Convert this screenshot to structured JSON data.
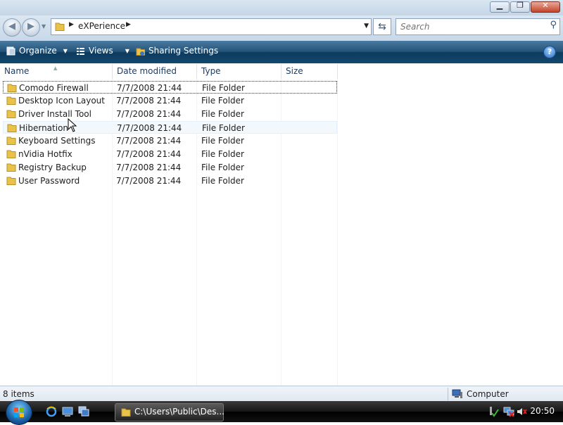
{
  "window": {
    "caption_buttons": {
      "minimize": "▁",
      "maximize": "❐",
      "close": "✕"
    }
  },
  "address": {
    "crumb": "eXPerience",
    "search_placeholder": "Search"
  },
  "toolbar": {
    "organize_label": "Organize",
    "views_label": "Views",
    "sharing_label": "Sharing Settings",
    "help_label": "?"
  },
  "columns": [
    "Name",
    "Date modified",
    "Type",
    "Size"
  ],
  "rows": [
    {
      "name": "Comodo Firewall",
      "date": "7/7/2008 21:44",
      "type": "File Folder"
    },
    {
      "name": "Desktop Icon Layout",
      "date": "7/7/2008 21:44",
      "type": "File Folder"
    },
    {
      "name": "Driver Install Tool",
      "date": "7/7/2008 21:44",
      "type": "File Folder"
    },
    {
      "name": "Hibernation",
      "date": "7/7/2008 21:44",
      "type": "File Folder"
    },
    {
      "name": "Keyboard Settings",
      "date": "7/7/2008 21:44",
      "type": "File Folder"
    },
    {
      "name": "nVidia Hotfix",
      "date": "7/7/2008 21:44",
      "type": "File Folder"
    },
    {
      "name": "Registry Backup",
      "date": "7/7/2008 21:44",
      "type": "File Folder"
    },
    {
      "name": "User Password",
      "date": "7/7/2008 21:44",
      "type": "File Folder"
    }
  ],
  "status": {
    "item_count": "8 items",
    "location": "Computer"
  },
  "taskbar": {
    "window_button": "C:\\Users\\Public\\Des...",
    "clock": "20:50"
  },
  "colors": {
    "command_bar": "#1b4a70",
    "folder": "#e9c24a",
    "taskbar": "#111111"
  }
}
